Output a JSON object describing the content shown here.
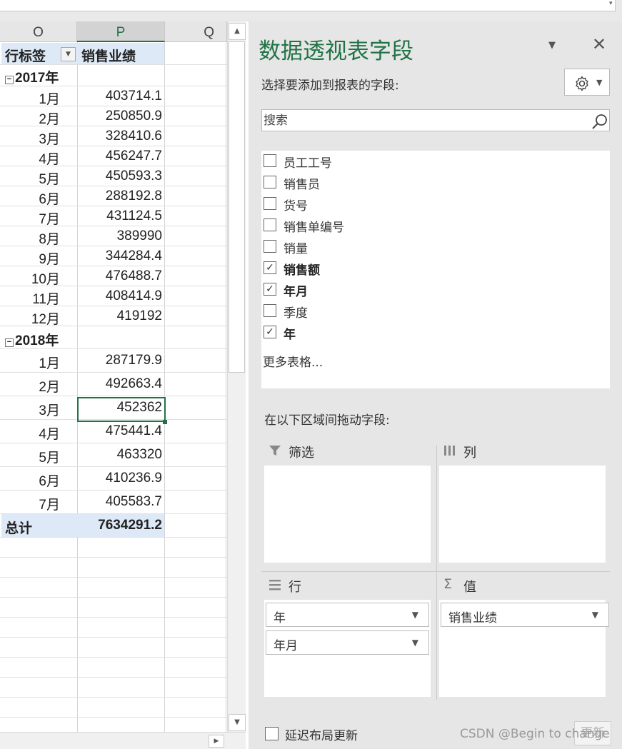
{
  "sheet": {
    "columns": [
      "O",
      "P",
      "Q"
    ],
    "selected_column": "P",
    "header": {
      "row_label": "行标签",
      "value_label": "销售业绩"
    },
    "groups": [
      {
        "label": "2017年",
        "rows": [
          {
            "label": "1月",
            "value": "403714.1"
          },
          {
            "label": "2月",
            "value": "250850.9"
          },
          {
            "label": "3月",
            "value": "328410.6"
          },
          {
            "label": "4月",
            "value": "456247.7"
          },
          {
            "label": "5月",
            "value": "450593.3"
          },
          {
            "label": "6月",
            "value": "288192.8"
          },
          {
            "label": "7月",
            "value": "431124.5"
          },
          {
            "label": "8月",
            "value": "389990"
          },
          {
            "label": "9月",
            "value": "344284.4"
          },
          {
            "label": "10月",
            "value": "476488.7"
          },
          {
            "label": "11月",
            "value": "408414.9"
          },
          {
            "label": "12月",
            "value": "419192"
          }
        ]
      },
      {
        "label": "2018年",
        "rows": [
          {
            "label": "1月",
            "value": "287179.9"
          },
          {
            "label": "2月",
            "value": "492663.4"
          },
          {
            "label": "3月",
            "value": "452362",
            "selected": true
          },
          {
            "label": "4月",
            "value": "475441.4"
          },
          {
            "label": "5月",
            "value": "463320"
          },
          {
            "label": "6月",
            "value": "410236.9"
          },
          {
            "label": "7月",
            "value": "405583.7"
          }
        ]
      }
    ],
    "total": {
      "label": "总计",
      "value": "7634291.2"
    }
  },
  "pane": {
    "title": "数据透视表字段",
    "choose_label": "选择要添加到报表的字段:",
    "search_placeholder": "搜索",
    "fields": [
      {
        "label": "员工工号",
        "checked": false
      },
      {
        "label": "销售员",
        "checked": false
      },
      {
        "label": "货号",
        "checked": false
      },
      {
        "label": "销售单编号",
        "checked": false
      },
      {
        "label": "销量",
        "checked": false
      },
      {
        "label": "销售额",
        "checked": true
      },
      {
        "label": "年月",
        "checked": true
      },
      {
        "label": "季度",
        "checked": false
      },
      {
        "label": "年",
        "checked": true
      }
    ],
    "more_tables": "更多表格...",
    "drag_label": "在以下区域间拖动字段:",
    "areas": {
      "filter": {
        "title": "筛选",
        "items": []
      },
      "columns": {
        "title": "列",
        "items": []
      },
      "rows": {
        "title": "行",
        "items": [
          "年",
          "年月"
        ]
      },
      "values": {
        "title": "值",
        "items": [
          "销售业绩"
        ]
      }
    },
    "defer_label": "延迟布局更新",
    "update_label": "更新"
  },
  "watermark": "CSDN @Begin to change",
  "colors": {
    "accent": "#217346",
    "header_band": "#dde9f6",
    "pane_bg": "#e6e6e6"
  }
}
